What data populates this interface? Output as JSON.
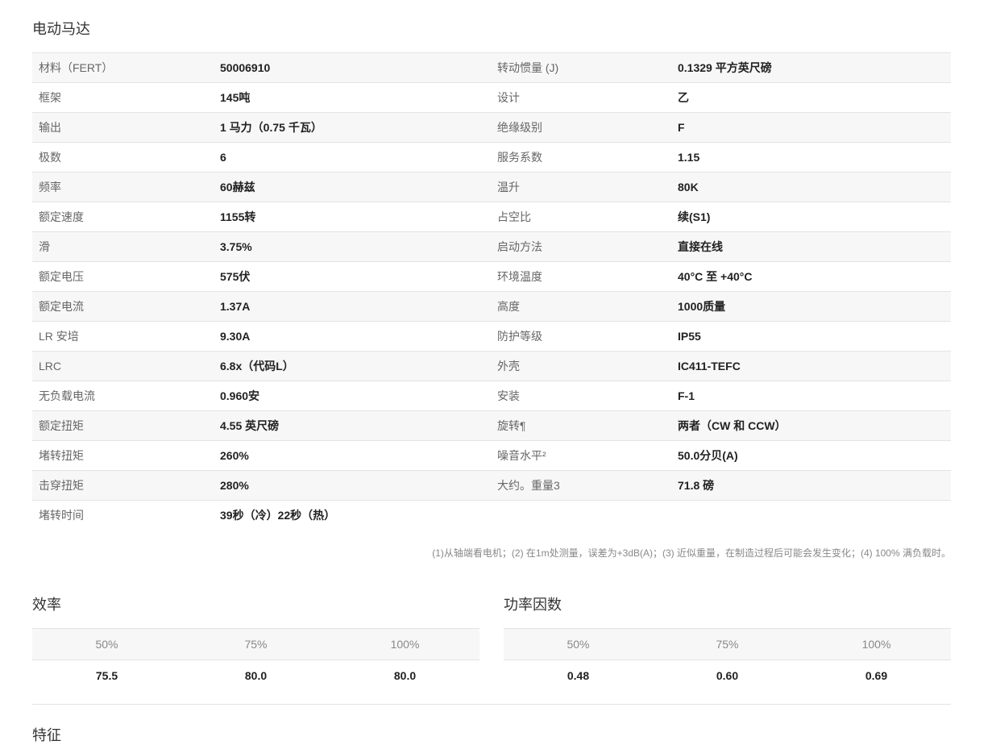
{
  "motor": {
    "title": "电动马达",
    "rows": [
      {
        "l1": "材料（FERT）",
        "v1": "50006910",
        "l2": "转动惯量 (J)",
        "v2": "0.1329 平方英尺磅"
      },
      {
        "l1": "框架",
        "v1": "145吨",
        "l2": "设计",
        "v2": "乙"
      },
      {
        "l1": "输出",
        "v1": "1 马力（0.75 千瓦）",
        "l2": "绝缘级别",
        "v2": "F"
      },
      {
        "l1": "极数",
        "v1": "6",
        "l2": "服务系数",
        "v2": "1.15"
      },
      {
        "l1": "频率",
        "v1": "60赫兹",
        "l2": "温升",
        "v2": "80K"
      },
      {
        "l1": "额定速度",
        "v1": "1155转",
        "l2": "占空比",
        "v2": "续(S1)"
      },
      {
        "l1": "滑",
        "v1": "3.75%",
        "l2": "启动方法",
        "v2": "直接在线"
      },
      {
        "l1": "额定电压",
        "v1": "575伏",
        "l2": "环境温度",
        "v2": "40°C 至 +40°C"
      },
      {
        "l1": "额定电流",
        "v1": "1.37A",
        "l2": "高度",
        "v2": "1000质量"
      },
      {
        "l1": "LR 安培",
        "v1": "9.30A",
        "l2": "防护等级",
        "v2": "IP55"
      },
      {
        "l1": "LRC",
        "v1": "6.8x（代码L）",
        "l2": "外壳",
        "v2": "IC411-TEFC"
      },
      {
        "l1": "无负载电流",
        "v1": "0.960安",
        "l2": "安装",
        "v2": "F-1"
      },
      {
        "l1": "额定扭矩",
        "v1": "4.55 英尺磅",
        "l2": "旋转¶",
        "v2": "两者（CW 和 CCW）"
      },
      {
        "l1": "堵转扭矩",
        "v1": "260%",
        "l2": "噪音水平²",
        "v2": "50.0分贝(A)"
      },
      {
        "l1": "击穿扭矩",
        "v1": "280%",
        "l2": "大约。重量3",
        "v2": "71.8 磅"
      },
      {
        "l1": "堵转时间",
        "v1": "39秒（冷）22秒（热）",
        "l2": "",
        "v2": ""
      }
    ],
    "footnote": "(1)从轴端看电机；(2) 在1m处测量，误差为+3dB(A)；(3) 近似重量，在制造过程后可能会发生变化；(4) 100% 满负载时。"
  },
  "efficiency": {
    "title": "效率",
    "headers": [
      "50%",
      "75%",
      "100%"
    ],
    "values": [
      "75.5",
      "80.0",
      "80.0"
    ]
  },
  "power_factor": {
    "title": "功率因数",
    "headers": [
      "50%",
      "75%",
      "100%"
    ],
    "values": [
      "0.48",
      "0.60",
      "0.69"
    ]
  },
  "next_section": {
    "title": "特征"
  }
}
